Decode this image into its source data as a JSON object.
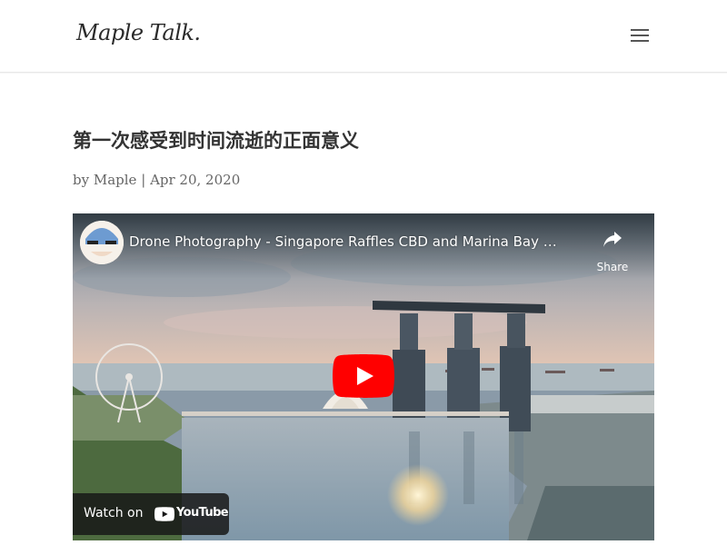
{
  "site": {
    "logo_text": "Maple Talk."
  },
  "header": {
    "menu_icon": "hamburger-menu-icon"
  },
  "post": {
    "title": "第一次感受到时间流逝的正面意义",
    "meta_by": "by",
    "author": "Maple",
    "separator": "|",
    "date": "Apr 20, 2020"
  },
  "video": {
    "title": "Drone Photography - Singapore Raffles CBD and Marina Bay …",
    "share_label": "Share",
    "watch_on_label": "Watch on",
    "platform_word": "YouTube",
    "icons": {
      "share": "share-arrow-icon",
      "play": "youtube-play-icon",
      "logo": "youtube-logo-icon"
    },
    "colors": {
      "play_red": "#ff0000",
      "sky_top": "#6f8596",
      "sky_horizon": "#e8c8b4",
      "water": "#8aa2b2"
    }
  }
}
